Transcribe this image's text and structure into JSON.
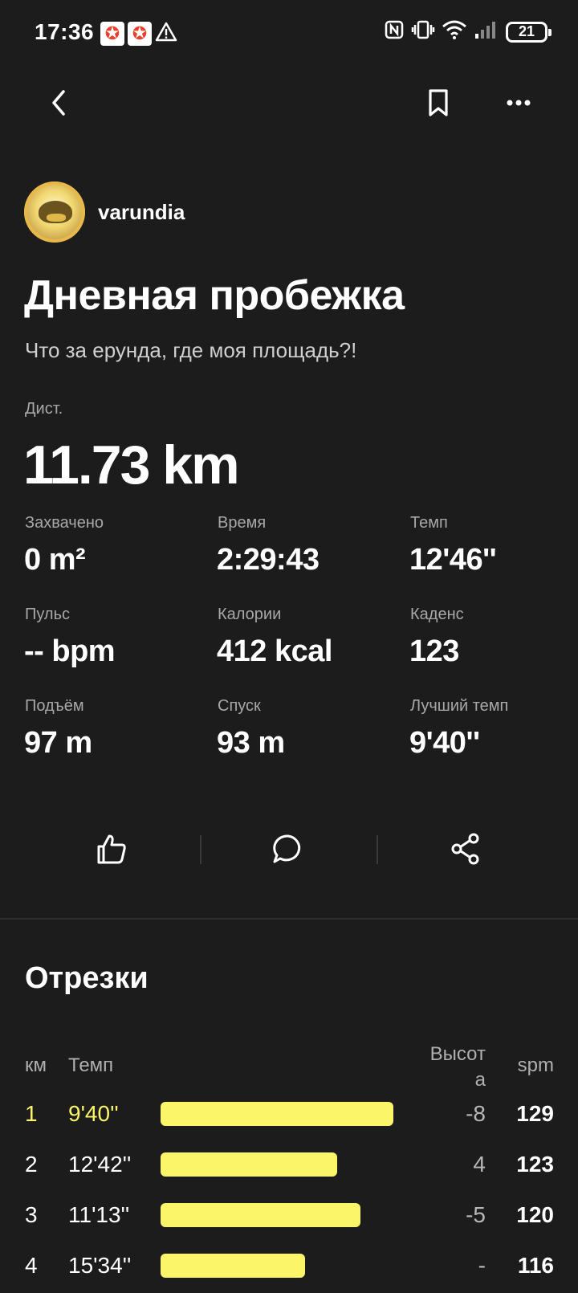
{
  "status_bar": {
    "time": "17:36",
    "battery": "21",
    "icons": [
      "app-notification-icon",
      "app-notification-icon",
      "warning-icon",
      "nfc-icon",
      "vibrate-icon",
      "wifi-icon",
      "signal-icon",
      "battery-icon"
    ]
  },
  "nav": {
    "back_icon": "chevron-left-icon",
    "bookmark_icon": "bookmark-icon",
    "more_icon": "more-horizontal-icon"
  },
  "user": {
    "name": "varundia"
  },
  "activity": {
    "title": "Дневная пробежка",
    "description": "Что за ерунда, где моя площадь?!",
    "distance_label": "Дист.",
    "distance_value": "11.73 km"
  },
  "stats": [
    {
      "label": "Захвачено",
      "value": "0 m²"
    },
    {
      "label": "Время",
      "value": "2:29:43"
    },
    {
      "label": "Темп",
      "value": "12'46''"
    },
    {
      "label": "Пульс",
      "value": "-- bpm"
    },
    {
      "label": "Калории",
      "value": "412 kcal"
    },
    {
      "label": "Каденс",
      "value": "123"
    },
    {
      "label": "Подъём",
      "value": "97 m"
    },
    {
      "label": "Спуск",
      "value": "93 m"
    },
    {
      "label": "Лучший темп",
      "value": "9'40''"
    }
  ],
  "actions": {
    "like_icon": "thumbs-up-icon",
    "comment_icon": "comment-icon",
    "share_icon": "share-icon"
  },
  "splits": {
    "title": "Отрезки",
    "headers": {
      "km": "км",
      "pace": "Темп",
      "elev_line1": "Высот",
      "elev_line2": "а",
      "spm": "spm"
    },
    "accent_color": "#fbf56a",
    "rows": [
      {
        "km": "1",
        "pace": "9'40''",
        "bar_fraction": 1.0,
        "elev": "-8",
        "spm": "129",
        "highlight": true
      },
      {
        "km": "2",
        "pace": "12'42''",
        "bar_fraction": 0.76,
        "elev": "4",
        "spm": "123",
        "highlight": false
      },
      {
        "km": "3",
        "pace": "11'13''",
        "bar_fraction": 0.86,
        "elev": "-5",
        "spm": "120",
        "highlight": false
      },
      {
        "km": "4",
        "pace": "15'34''",
        "bar_fraction": 0.62,
        "elev": "-",
        "spm": "116",
        "highlight": false
      }
    ]
  }
}
